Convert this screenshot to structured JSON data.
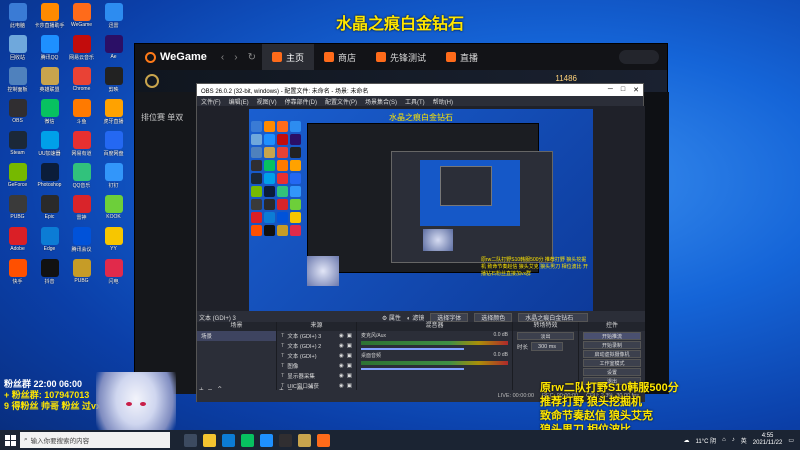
{
  "banner_title": "水晶之痕白金钻石",
  "desktop_icons": [
    {
      "label": "此电脑",
      "color": "#3a7bd5"
    },
    {
      "label": "卡莎直播助手",
      "color": "#ff8a00"
    },
    {
      "label": "WeGame",
      "color": "#ff6b1a"
    },
    {
      "label": "迅雷",
      "color": "#2d8cf0"
    },
    {
      "label": "回收站",
      "color": "#6fa8dc"
    },
    {
      "label": "腾讯QQ",
      "color": "#1e90ff"
    },
    {
      "label": "网易云音乐",
      "color": "#c20c0c"
    },
    {
      "label": "Ae",
      "color": "#2b0f66"
    },
    {
      "label": "控制面板",
      "color": "#4f81bd"
    },
    {
      "label": "英雄联盟",
      "color": "#c8a44d"
    },
    {
      "label": "Chrome",
      "color": "#e94235"
    },
    {
      "label": "剪映",
      "color": "#222"
    },
    {
      "label": "OBS",
      "color": "#302e31"
    },
    {
      "label": "微信",
      "color": "#07c160"
    },
    {
      "label": "斗鱼",
      "color": "#ff7a00"
    },
    {
      "label": "虎牙直播",
      "color": "#ffa200"
    },
    {
      "label": "Steam",
      "color": "#1b2838"
    },
    {
      "label": "UU加速器",
      "color": "#00a0e9"
    },
    {
      "label": "网易有道",
      "color": "#e83030"
    },
    {
      "label": "百度网盘",
      "color": "#2468f2"
    },
    {
      "label": "GeForce",
      "color": "#76b900"
    },
    {
      "label": "Photoshop",
      "color": "#0b1d3a"
    },
    {
      "label": "QQ音乐",
      "color": "#31c27c"
    },
    {
      "label": "钉钉",
      "color": "#3296fa"
    },
    {
      "label": "PUBG",
      "color": "#3a3a3a"
    },
    {
      "label": "Epic",
      "color": "#2a2a2a"
    },
    {
      "label": "雷神",
      "color": "#d9242a"
    },
    {
      "label": "KOOK",
      "color": "#6dcf3a"
    },
    {
      "label": "Adobe",
      "color": "#da1f26"
    },
    {
      "label": "Edge",
      "color": "#0c7cd5"
    },
    {
      "label": "腾讯会议",
      "color": "#0052d9"
    },
    {
      "label": "YY",
      "color": "#f7c600"
    },
    {
      "label": "快手",
      "color": "#ff5000"
    },
    {
      "label": "抖音",
      "color": "#111"
    },
    {
      "label": "PUBG",
      "color": "#c69c27"
    },
    {
      "label": "闪电",
      "color": "#e12a4b"
    }
  ],
  "wegame": {
    "logo": "WeGame",
    "tabs": [
      {
        "label": "主页",
        "active": true
      },
      {
        "label": "商店",
        "active": false
      },
      {
        "label": "先锋测试",
        "active": false
      },
      {
        "label": "直播",
        "active": false
      }
    ],
    "stat": "11486",
    "sidebar_rows": [
      "排位赛 单双"
    ]
  },
  "obs": {
    "title": "OBS 26.0.2 (32-bit, windows) - 配置文件: 未命名 - 场景: 未命名",
    "menu": [
      "文件(F)",
      "编辑(E)",
      "视图(V)",
      "停靠部件(D)",
      "配置文件(P)",
      "场景集合(S)",
      "工具(T)",
      "帮助(H)"
    ],
    "preview_title": "水晶之痕白金钻石",
    "preview_caption": "原rw二队打野S10韩服500分 推荐打野 狼头挖掘机 致命节奏赵信 狼头艾克 狼头男刀 相位波比 开播钻石粉丝直接加vx群",
    "source_strip": {
      "current": "文本 (GDI+) 3",
      "properties": "属性",
      "filters": "滤镜",
      "select_font": "选择字体",
      "select_color": "选择颜色",
      "text_value": "水晶之痕白金钻石"
    },
    "docks": {
      "scenes_header": "场景",
      "scenes": [
        "场景"
      ],
      "sources_header": "来源",
      "sources": [
        "文本 (GDI+) 3",
        "文本 (GDI+) 2",
        "文本 (GDI+)",
        "图像",
        "显示器采集",
        "UIC窗口捕获"
      ],
      "mixer_header": "混音器",
      "mixer": [
        {
          "name": "麦克风/Aux",
          "db": "0.0 dB"
        },
        {
          "name": "桌面音频",
          "db": "0.0 dB"
        }
      ],
      "transitions_header": "转场特效",
      "transition": "淡出",
      "duration_label": "时长",
      "duration": "300 ms",
      "controls_header": "控件",
      "controls": [
        "开始推流",
        "开始录制",
        "启动虚拟摄像机",
        "工作室模式",
        "设置",
        "退出"
      ]
    },
    "status": {
      "live": "LIVE: 00:00:00",
      "rec": "REC: 00:00:00",
      "cpu": "CPU: 2.3%, 30.00 fps"
    }
  },
  "chat_lines": [
    {
      "text": "粉丝群 22:00 06:00",
      "color": "#ffffff"
    },
    {
      "text": "+ 粉丝群: 107947013",
      "color": "#ffe600"
    },
    {
      "text": "9 得粉丝 帅哥 粉丝 过vx群",
      "color": "#ffe600"
    }
  ],
  "goal_lines": [
    {
      "text": "原rw二队打野S10韩服500分",
      "color": "#ffe600"
    },
    {
      "text": "推荐打野 狼头挖掘机",
      "color": "#ffe600"
    },
    {
      "text": "致命节奏赵信 狼头艾克",
      "color": "#ffe600"
    },
    {
      "text": "狼头男刀 相位波比",
      "color": "#ffe600"
    },
    {
      "text": "开播钻石粉丝直接加vx群",
      "color": "#ffe600"
    }
  ],
  "taskbar": {
    "search_placeholder": "输入你要搜索的内容",
    "weather": "11°C 阴",
    "time": "4:55",
    "date": "2021/11/22",
    "ime": "英"
  }
}
